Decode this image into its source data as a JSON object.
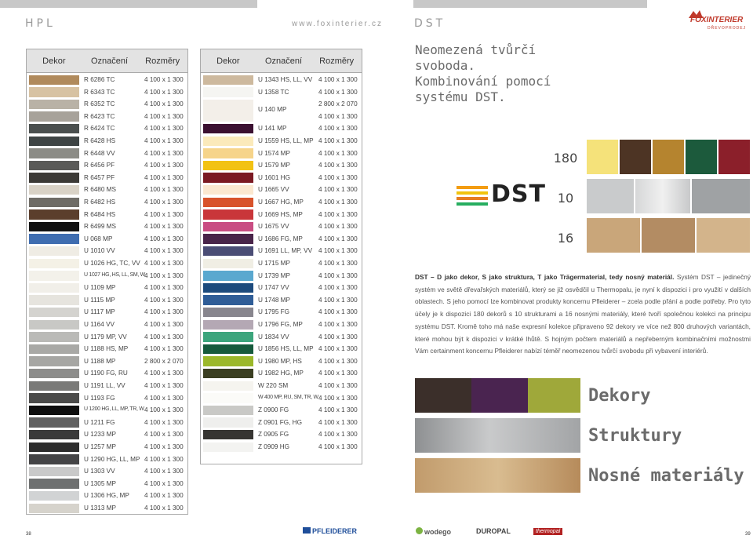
{
  "header": {
    "left_title": "HPL",
    "url": "www.foxinterier.cz",
    "right_title": "DST",
    "logo_text": "FOXINTERIER",
    "logo_sub": "DŘEVOPRODEJ"
  },
  "table_headers": {
    "col1": "Dekor",
    "col2": "Označení",
    "col3": "Rozměry"
  },
  "left_table": [
    {
      "code": "R 6286 TC",
      "dim": "4 100 x 1 300",
      "color": "#b08a5c"
    },
    {
      "code": "R 6343 TC",
      "dim": "4 100 x 1 300",
      "color": "#d7c2a2"
    },
    {
      "code": "R 6352 TC",
      "dim": "4 100 x 1 300",
      "color": "#b9b2a6"
    },
    {
      "code": "R 6423 TC",
      "dim": "4 100 x 1 300",
      "color": "#a7a29a"
    },
    {
      "code": "R 6424 TC",
      "dim": "4 100 x 1 300",
      "color": "#4a4f4e"
    },
    {
      "code": "R 6428 HS",
      "dim": "4 100 x 1 300",
      "color": "#3e4444"
    },
    {
      "code": "R 6448 VV",
      "dim": "4 100 x 1 300",
      "color": "#8c8c86"
    },
    {
      "code": "R 6456 PF",
      "dim": "4 100 x 1 300",
      "color": "#5a5a58"
    },
    {
      "code": "R 6457 PF",
      "dim": "4 100 x 1 300",
      "color": "#3c3a36"
    },
    {
      "code": "R 6480 MS",
      "dim": "4 100 x 1 300",
      "color": "#d9d2c6"
    },
    {
      "code": "R 6482 HS",
      "dim": "4 100 x 1 300",
      "color": "#6f6c66"
    },
    {
      "code": "R 6484 HS",
      "dim": "4 100 x 1 300",
      "color": "#5b3e2c"
    },
    {
      "code": "R 6499 MS",
      "dim": "4 100 x 1 300",
      "color": "#111111"
    },
    {
      "code": "U 068 MP",
      "dim": "4 100 x 1 300",
      "color": "#3f6db0"
    },
    {
      "code": "U 1010 VV",
      "dim": "4 100 x 1 300",
      "color": "#efece4"
    },
    {
      "code": "U 1026 HG, TC, VV",
      "dim": "4 100 x 1 300",
      "color": "#f4f1e6"
    },
    {
      "code": "U 1027 HG, HS, LL, SM, W",
      "dim": "4 100 x 1 300",
      "color": "#f3f1ea"
    },
    {
      "code": "U 1109 MP",
      "dim": "4 100 x 1 300",
      "color": "#f1efe9"
    },
    {
      "code": "U 1115 MP",
      "dim": "4 100 x 1 300",
      "color": "#e6e4de"
    },
    {
      "code": "U 1117 MP",
      "dim": "4 100 x 1 300",
      "color": "#d4d3cf"
    },
    {
      "code": "U 1164 VV",
      "dim": "4 100 x 1 300",
      "color": "#c8c8c5"
    },
    {
      "code": "U 1179 MP, VV",
      "dim": "4 100 x 1 300",
      "color": "#babab7"
    },
    {
      "code": "U 1188 HS, MP",
      "dim": "4 100 x 1 300",
      "color": "#a9a9a6"
    },
    {
      "code": "U 1188 MP",
      "dim": "2 800 x 2 070",
      "color": "#a6a6a3"
    },
    {
      "code": "U 1190 FG, RU",
      "dim": "4 100 x 1 300",
      "color": "#8d8d8b"
    },
    {
      "code": "U 1191 LL, VV",
      "dim": "4 100 x 1 300",
      "color": "#7a7a78"
    },
    {
      "code": "U 1193 FG",
      "dim": "4 100 x 1 300",
      "color": "#4b4b4a"
    },
    {
      "code": "U 1200 HG, LL, MP, TR, W",
      "dim": "4 100 x 1 300",
      "color": "#0e0e0e"
    },
    {
      "code": "U 1211 FG",
      "dim": "4 100 x 1 300",
      "color": "#616161"
    },
    {
      "code": "U 1233 MP",
      "dim": "4 100 x 1 300",
      "color": "#3a3a3a"
    },
    {
      "code": "U 1257 MP",
      "dim": "4 100 x 1 300",
      "color": "#2d2d2d"
    },
    {
      "code": "U 1290 HG, LL, MP",
      "dim": "4 100 x 1 300",
      "color": "#444446"
    },
    {
      "code": "U 1303 VV",
      "dim": "4 100 x 1 300",
      "color": "#c9c9c9"
    },
    {
      "code": "U 1305 MP",
      "dim": "4 100 x 1 300",
      "color": "#6e7070"
    },
    {
      "code": "U 1306 HG, MP",
      "dim": "4 100 x 1 300",
      "color": "#d1d3d4"
    },
    {
      "code": "U 1313 MP",
      "dim": "4 100 x 1 300",
      "color": "#d6d3cc"
    }
  ],
  "right_table": [
    {
      "code": "U 1343 HS, LL, VV",
      "dim": "4 100 x 1 300",
      "color": "#cdb99e",
      "span": 1
    },
    {
      "code": "U 1358 TC",
      "dim": "4 100 x 1 300",
      "color": "#f5f5f2",
      "span": 1
    },
    {
      "code": "U 140 MP",
      "dim": "2 800 x 2 070",
      "dim2": "4 100 x 1 300",
      "color": "#f3efe9",
      "span": 2
    },
    {
      "code": "U 141 MP",
      "dim": "4 100 x 1 300",
      "color": "#3b1030",
      "span": 1
    },
    {
      "code": "U 1559 HS, LL, MP",
      "dim": "4 100 x 1 300",
      "color": "#fbeabb",
      "span": 1
    },
    {
      "code": "U 1574 MP",
      "dim": "4 100 x 1 300",
      "color": "#f6d48a",
      "span": 1
    },
    {
      "code": "U 1579 MP",
      "dim": "4 100 x 1 300",
      "color": "#f2c213",
      "span": 1
    },
    {
      "code": "U 1601 HG",
      "dim": "4 100 x 1 300",
      "color": "#7b1a23",
      "span": 1
    },
    {
      "code": "U 1665 VV",
      "dim": "4 100 x 1 300",
      "color": "#fbe8d0",
      "span": 1
    },
    {
      "code": "U 1667 HG, MP",
      "dim": "4 100 x 1 300",
      "color": "#d8532b",
      "span": 1
    },
    {
      "code": "U 1669 HS, MP",
      "dim": "4 100 x 1 300",
      "color": "#c9363a",
      "span": 1
    },
    {
      "code": "U 1675 VV",
      "dim": "4 100 x 1 300",
      "color": "#c94d83",
      "span": 1
    },
    {
      "code": "U 1686 FG, MP",
      "dim": "4 100 x 1 300",
      "color": "#492449",
      "span": 1
    },
    {
      "code": "U 1691 LL, MP, VV",
      "dim": "4 100 x 1 300",
      "color": "#4b4d75",
      "span": 1
    },
    {
      "code": "U 1715 MP",
      "dim": "4 100 x 1 300",
      "color": "#f0eee4",
      "span": 1
    },
    {
      "code": "U 1739 MP",
      "dim": "4 100 x 1 300",
      "color": "#5aa8cf",
      "span": 1
    },
    {
      "code": "U 1747 VV",
      "dim": "4 100 x 1 300",
      "color": "#1d4b7d",
      "span": 1
    },
    {
      "code": "U 1748 MP",
      "dim": "4 100 x 1 300",
      "color": "#2f5d97",
      "span": 1
    },
    {
      "code": "U 1795 FG",
      "dim": "4 100 x 1 300",
      "color": "#88868e",
      "span": 1
    },
    {
      "code": "U 1796 FG, MP",
      "dim": "4 100 x 1 300",
      "color": "#b4a8b4",
      "span": 1
    },
    {
      "code": "U 1834 VV",
      "dim": "4 100 x 1 300",
      "color": "#3ca57c",
      "span": 1
    },
    {
      "code": "U 1856 HS, LL, MP",
      "dim": "4 100 x 1 300",
      "color": "#165a3c",
      "span": 1
    },
    {
      "code": "U 1980 MP, HS",
      "dim": "4 100 x 1 300",
      "color": "#9bb82a",
      "span": 1
    },
    {
      "code": "U 1982 HG, MP",
      "dim": "4 100 x 1 300",
      "color": "#3b3f22",
      "span": 1
    },
    {
      "code": "W 220 SM",
      "dim": "4 100 x 1 300",
      "color": "#f5f4ef",
      "span": 1
    },
    {
      "code": "W 400 MP, RU, SM, TR, W",
      "dim": "4 100 x 1 300",
      "color": "#fbfbf8",
      "span": 1
    },
    {
      "code": "Z 0900 FG",
      "dim": "4 100 x 1 300",
      "color": "#c9c9c6",
      "span": 1
    },
    {
      "code": "Z 0901 FG, HG",
      "dim": "4 100 x 1 300",
      "color": "#efefed",
      "span": 1
    },
    {
      "code": "Z 0905 FG",
      "dim": "4 100 x 1 300",
      "color": "#363532",
      "span": 1
    },
    {
      "code": "Z 0909 HG",
      "dim": "4 100 x 1 300",
      "color": "#f3f3f1",
      "span": 1
    }
  ],
  "headline": [
    "Neomezená tvůrčí",
    "svoboda.",
    "Kombinování pomocí",
    "systému DST."
  ],
  "dst_logo": "DST",
  "dst_numbers": [
    "180",
    "10",
    "16"
  ],
  "paragraph": {
    "bold": "DST – D jako dekor, S jako struktura, T jako Trägermaterial, tedy nosný materiál.",
    "text": " Systém DST – jedinečný systém ve světě dřevařských materiálů, který se již osvědčil u Thermopalu, je nyní k dispozici i pro využití v dalších oblastech. S jeho pomocí lze kombinovat produkty koncernu Pfleiderer – zcela podle přání a podle potřeby. Pro tyto účely je k dispozici 180 dekorů s 10 strukturami a 16 nosnými materiály, které tvoří společnou kolekci na principu systému DST. Kromě toho má naše expresní kolekce připraveno 92 dekory ve více než 800 druhových variantách, které mohou být k dispozici v krátké lhůtě. S hojným počtem materiálů a nepřeberným kombinačními možnostmi Vám certainment koncernu Pfleiderer nabízí téměř neomezenou tvůrčí svobodu při vybavení interiérů."
  },
  "categories": [
    "Dekory",
    "Struktury",
    "Nosné materiály"
  ],
  "footer": {
    "page_left": "38",
    "page_right": "39",
    "brand_center": "PFLEIDERER",
    "brand_1": "wodego",
    "brand_2": "DUROPAL",
    "brand_3": "thermopal"
  },
  "colors": {
    "accent_red": "#c0392b",
    "header_gray": "#e3e3e3"
  }
}
